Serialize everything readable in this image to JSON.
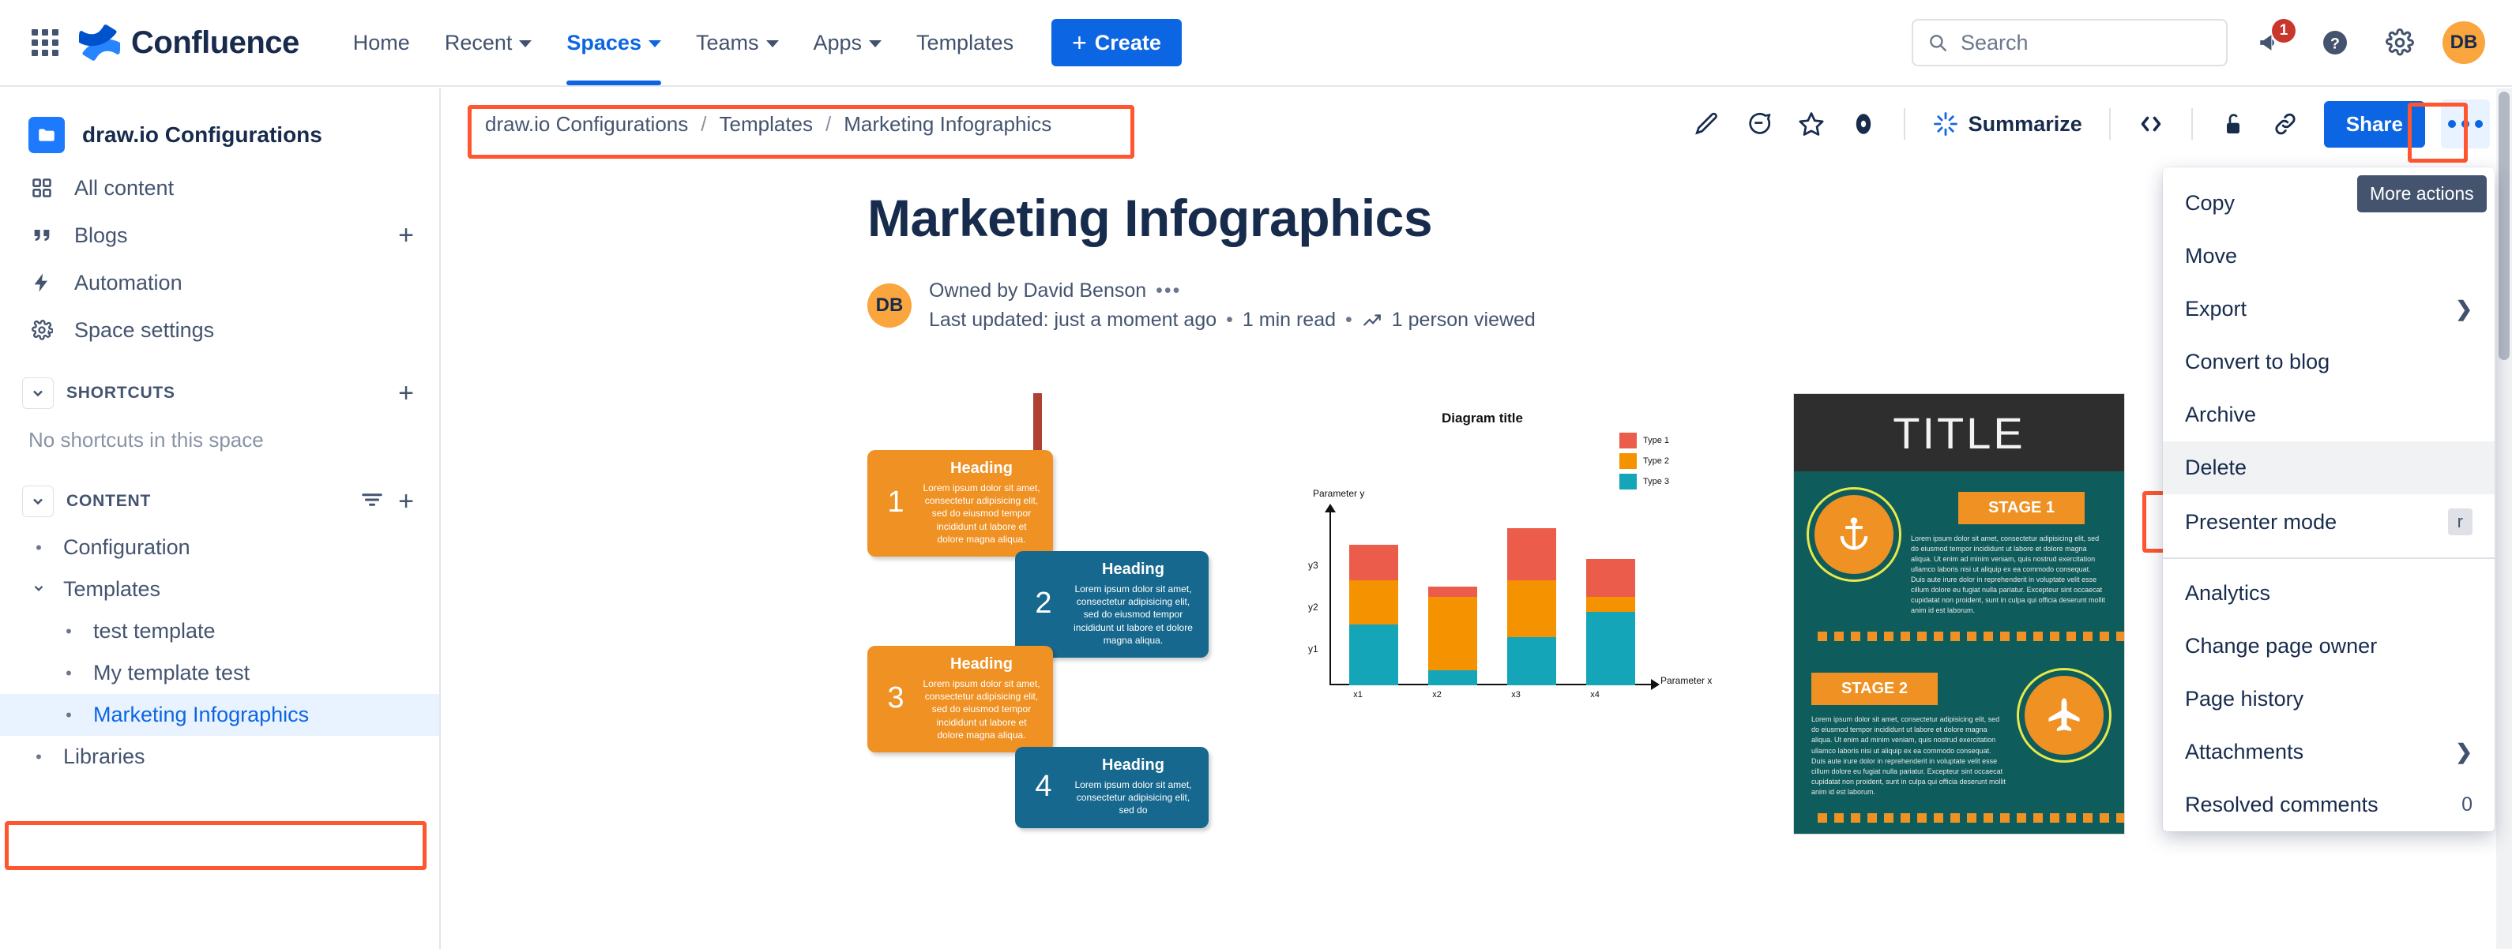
{
  "topnav": {
    "app_switcher": "app-switcher",
    "brand": "Confluence",
    "links": [
      {
        "label": "Home",
        "has_caret": false,
        "active": false
      },
      {
        "label": "Recent",
        "has_caret": true,
        "active": false
      },
      {
        "label": "Spaces",
        "has_caret": true,
        "active": true
      },
      {
        "label": "Teams",
        "has_caret": true,
        "active": false
      },
      {
        "label": "Apps",
        "has_caret": true,
        "active": false
      },
      {
        "label": "Templates",
        "has_caret": false,
        "active": false
      }
    ],
    "create_label": "Create",
    "search_placeholder": "Search",
    "notification_count": "1",
    "avatar_initials": "DB"
  },
  "sidebar": {
    "space_name": "draw.io Configurations",
    "nav": [
      {
        "label": "All content",
        "icon": "grid-icon",
        "action": ""
      },
      {
        "label": "Blogs",
        "icon": "quote-icon",
        "action": "+"
      },
      {
        "label": "Automation",
        "icon": "bolt-icon",
        "action": ""
      },
      {
        "label": "Space settings",
        "icon": "gear-icon",
        "action": ""
      }
    ],
    "shortcuts": {
      "title": "SHORTCUTS",
      "empty": "No shortcuts in this space",
      "add": "+"
    },
    "content": {
      "title": "CONTENT",
      "items": [
        {
          "label": "Configuration",
          "level": 1,
          "expandable": false,
          "selected": false
        },
        {
          "label": "Templates",
          "level": 1,
          "expandable": true,
          "selected": false
        },
        {
          "label": "test template",
          "level": 2,
          "expandable": false,
          "selected": false
        },
        {
          "label": "My template test",
          "level": 2,
          "expandable": false,
          "selected": false
        },
        {
          "label": "Marketing Infographics",
          "level": 2,
          "expandable": false,
          "selected": true
        },
        {
          "label": "Libraries",
          "level": 1,
          "expandable": false,
          "selected": false
        }
      ]
    }
  },
  "pagebar": {
    "breadcrumbs": [
      "draw.io Configurations",
      "Templates",
      "Marketing Infographics"
    ],
    "separator": "/",
    "tools": [
      {
        "name": "edit-pencil-icon"
      },
      {
        "name": "comment-icon"
      },
      {
        "name": "star-icon"
      },
      {
        "name": "watch-eye-icon"
      }
    ],
    "summarize_label": "Summarize",
    "code_icon": "code-icon",
    "lock_icon": "unlock-icon",
    "link_icon": "copy-link-icon",
    "share_label": "Share",
    "more_label": "More actions",
    "tooltip": "More actions"
  },
  "page": {
    "title": "Marketing Infographics",
    "owner_avatar": "DB",
    "owned_by": "Owned by David Benson",
    "owner_more": "•••",
    "last_updated": "Last updated: just a moment ago",
    "read_time": "1 min read",
    "views": "1 person viewed",
    "dot": "•"
  },
  "menu": {
    "items": [
      {
        "label": "Copy",
        "type": "item",
        "suffix": "",
        "highlight": false
      },
      {
        "label": "Move",
        "type": "item",
        "suffix": "",
        "highlight": false
      },
      {
        "label": "Export",
        "type": "submenu",
        "suffix": "❯",
        "highlight": false
      },
      {
        "label": "Convert to blog",
        "type": "item",
        "suffix": "",
        "highlight": false
      },
      {
        "label": "Archive",
        "type": "item",
        "suffix": "",
        "highlight": false
      },
      {
        "label": "Delete",
        "type": "item",
        "suffix": "",
        "highlight": true
      },
      {
        "label": "Presenter mode",
        "type": "shortcut",
        "suffix": "r",
        "highlight": false
      },
      {
        "label": "divider",
        "type": "divider",
        "suffix": "",
        "highlight": false
      },
      {
        "label": "Analytics",
        "type": "item",
        "suffix": "",
        "highlight": false
      },
      {
        "label": "Change page owner",
        "type": "item",
        "suffix": "",
        "highlight": false
      },
      {
        "label": "Page history",
        "type": "item",
        "suffix": "",
        "highlight": false
      },
      {
        "label": "Attachments",
        "type": "submenu",
        "suffix": "❯",
        "highlight": false
      },
      {
        "label": "Resolved comments",
        "type": "count",
        "suffix": "0",
        "highlight": false
      }
    ]
  },
  "infographics": {
    "timeline": {
      "steps": [
        {
          "num": "1",
          "heading": "Heading",
          "body": "Lorem ipsum dolor sit amet, consectetur adipisicing elit, sed do eiusmod tempor incididunt ut labore et dolore magna aliqua.",
          "side": "left",
          "color": "orange"
        },
        {
          "num": "2",
          "heading": "Heading",
          "body": "Lorem ipsum dolor sit amet, consectetur adipisicing elit, sed do eiusmod tempor incididunt ut labore et dolore magna aliqua.",
          "side": "right",
          "color": "blue"
        },
        {
          "num": "3",
          "heading": "Heading",
          "body": "Lorem ipsum dolor sit amet, consectetur adipisicing elit, sed do eiusmod tempor incididunt ut labore et dolore magna aliqua.",
          "side": "left",
          "color": "orange"
        },
        {
          "num": "4",
          "heading": "Heading",
          "body": "Lorem ipsum dolor sit amet, consectetur adipisicing elit, sed do",
          "side": "right",
          "color": "blue"
        }
      ]
    },
    "poster": {
      "title": "TITLE",
      "stages": [
        {
          "chip": "STAGE 1",
          "icon": "anchor-icon",
          "side": "right",
          "body": "Lorem ipsum dolor sit amet, consectetur adipisicing elit, sed do eiusmod tempor incididunt ut labore et dolore magna aliqua. Ut enim ad minim veniam, quis nostrud exercitation ullamco laboris nisi ut aliquip ex ea commodo consequat. Duis aute irure dolor in reprehenderit in voluptate velit esse cillum dolore eu fugiat nulla pariatur. Excepteur sint occaecat cupidatat non proident, sunt in culpa qui officia deserunt mollit anim id est laborum."
        },
        {
          "chip": "STAGE 2",
          "icon": "airplane-icon",
          "side": "left",
          "body": "Lorem ipsum dolor sit amet, consectetur adipisicing elit, sed do eiusmod tempor incididunt ut labore et dolore magna aliqua. Ut enim ad minim veniam, quis nostrud exercitation ullamco laboris nisi ut aliquip ex ea commodo consequat. Duis aute irure dolor in reprehenderit in voluptate velit esse cillum dolore eu fugiat nulla pariatur. Excepteur sint occaecat cupidatat non proident, sunt in culpa qui officia deserunt mollit anim id est laborum."
        }
      ]
    }
  },
  "chart_data": {
    "type": "bar",
    "subtype": "stacked",
    "title": "Diagram title",
    "xlabel": "Parameter x",
    "ylabel": "Parameter y",
    "categories": [
      "x1",
      "x2",
      "x3",
      "x4"
    ],
    "ytick_labels": [
      "y1",
      "y2",
      "y3"
    ],
    "ytick_values": [
      1,
      2,
      3
    ],
    "ylim": [
      0,
      4.2
    ],
    "grid": false,
    "legend_position": "top-right",
    "series": [
      {
        "name": "Type 3",
        "color": "#14a5b8",
        "values": [
          1.45,
          0.35,
          1.15,
          1.75
        ]
      },
      {
        "name": "Type 2",
        "color": "#f49200",
        "values": [
          1.05,
          1.75,
          1.35,
          0.35
        ]
      },
      {
        "name": "Type 1",
        "color": "#eb5d4a",
        "values": [
          0.85,
          0.25,
          1.25,
          0.9
        ]
      }
    ],
    "legend_order": [
      "Type 1",
      "Type 2",
      "Type 3"
    ]
  },
  "colors": {
    "brand_blue": "#0c66e4",
    "highlight_red": "#ff5630",
    "avatar_orange": "#faa53d",
    "badge_red": "#c9372c",
    "selected_bg": "#e9f2ff"
  }
}
